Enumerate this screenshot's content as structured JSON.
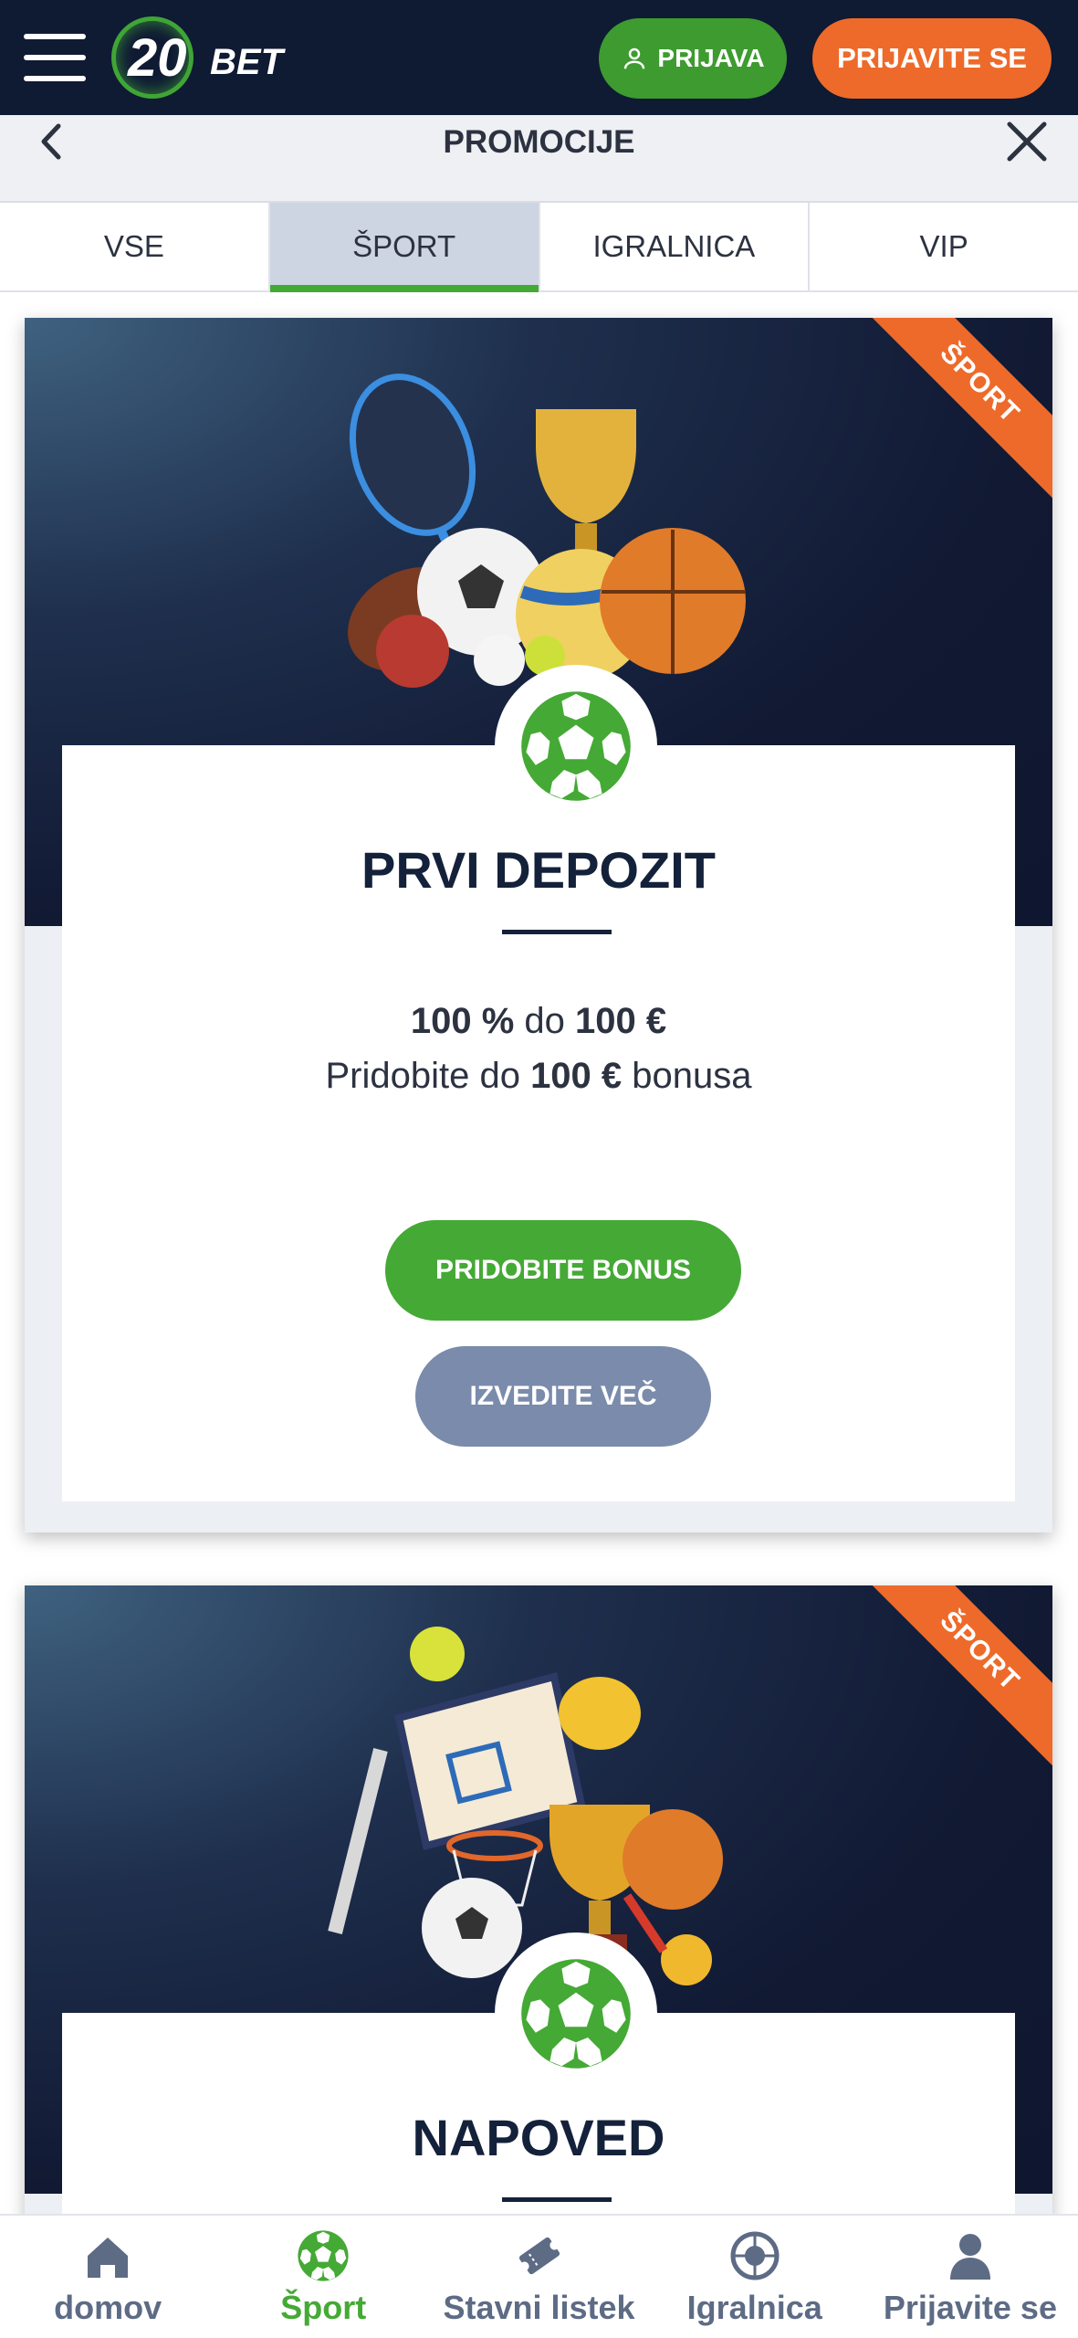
{
  "header": {
    "logo_number": "20",
    "logo_text": "BET",
    "login_label": "PRIJAVA",
    "register_label": "PRIJAVITE SE",
    "colors": {
      "bg": "#0f1a33",
      "login": "#3d9b2f",
      "register": "#ee6a2a"
    }
  },
  "subheader": {
    "title": "PROMOCIJE",
    "back_icon": "chevron-left-icon",
    "close_icon": "close-icon"
  },
  "tabs": [
    {
      "label": "VSE",
      "active": false
    },
    {
      "label": "ŠPORT",
      "active": true
    },
    {
      "label": "IGRALNICA",
      "active": false
    },
    {
      "label": "VIP",
      "active": false
    }
  ],
  "promos": [
    {
      "ribbon": "ŠPORT",
      "title": "PRVI DEPOZIT",
      "line1": {
        "a": "100 %",
        "b": " do ",
        "c": "100 €"
      },
      "line2": {
        "a": "Pridobite do ",
        "b": "100 €",
        "c": " bonusa"
      },
      "primary_label": "PRIDOBITE BONUS",
      "secondary_label": "IZVEDITE VEČ"
    },
    {
      "ribbon": "ŠPORT",
      "title": "NAPOVED"
    }
  ],
  "bottom_nav": [
    {
      "label": "domov",
      "icon": "home-icon",
      "active": false
    },
    {
      "label": "Šport",
      "icon": "soccer-ball-icon",
      "active": true
    },
    {
      "label": "Stavni listek",
      "icon": "ticket-icon",
      "active": false
    },
    {
      "label": "Igralnica",
      "icon": "roulette-icon",
      "active": false
    },
    {
      "label": "Prijavite se",
      "icon": "user-icon",
      "active": false
    }
  ],
  "accent_colors": {
    "green": "#45a935",
    "orange": "#ee6a2a",
    "navy": "#14213a",
    "grey_button": "#7a8bab"
  }
}
